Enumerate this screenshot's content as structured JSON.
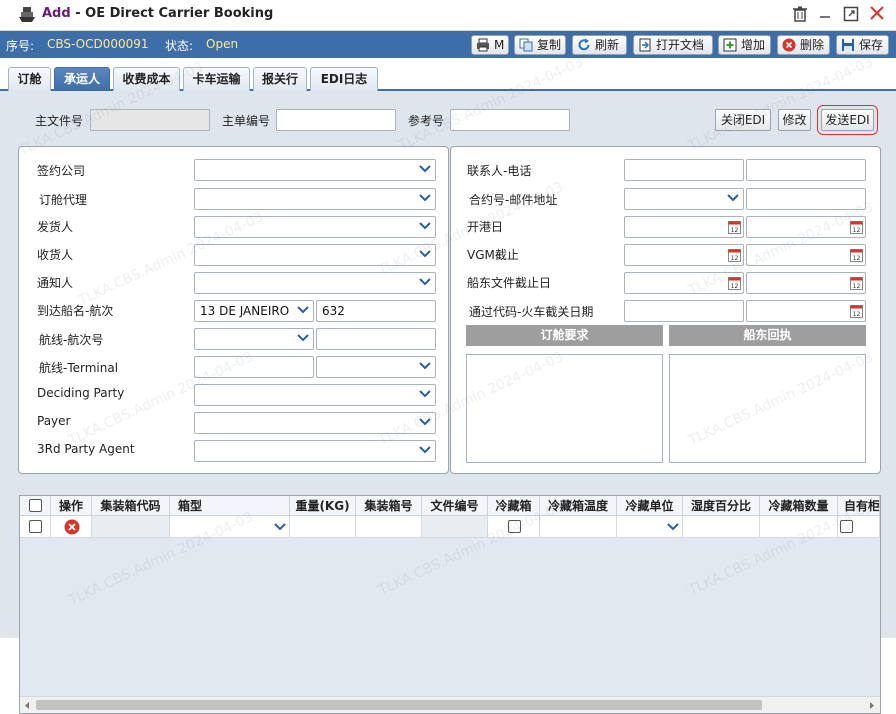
{
  "window": {
    "add_label": "Add",
    "title_sep": " - ",
    "title": "OE Direct Carrier Booking"
  },
  "info": {
    "seq_label": "序号:",
    "seq_value": "CBS-OCD000091",
    "status_label": "状态:",
    "status_value": "Open"
  },
  "toolbar": {
    "print": "M",
    "copy": "复制",
    "refresh": "刷新",
    "open_doc": "打开文档",
    "add": "增加",
    "delete": "删除",
    "save": "保存"
  },
  "tabs": [
    "订舱",
    "承运人",
    "收费成本",
    "卡车运输",
    "报关行",
    "EDI日志"
  ],
  "header_fields": {
    "main_doc_label": "主文件号",
    "main_doc_value": "",
    "master_no_label": "主单编号",
    "master_no_value": "",
    "ref_label": "参考号",
    "ref_value": "",
    "close_edi": "关闭EDI",
    "modify": "修改",
    "send_edi": "发送EDI"
  },
  "left": {
    "contract_company": "签约公司",
    "booking_agent": "订舱代理",
    "shipper": "发货人",
    "consignee": "收货人",
    "notify": "通知人",
    "vessel_label": "到达船名-航次",
    "vessel_value": "13 DE JANEIRO",
    "voyage_value": "632",
    "route_voyage": "航线-航次号",
    "route_terminal": "航线-Terminal",
    "deciding_party": "Deciding Party",
    "payer": "Payer",
    "third_party": "3Rd Party Agent"
  },
  "right": {
    "contact_phone": "联系人-电话",
    "contract_mail": "合约号-邮件地址",
    "sail_date": "开港日",
    "vgm_cutoff": "VGM截止",
    "doc_cutoff": "船东文件截止日",
    "pass_code": "通过代码-火车截关日期",
    "booking_req": "订舱要求",
    "carrier_reply": "船东回执"
  },
  "grid": {
    "headers": [
      "操作",
      "集装箱代码",
      "箱型",
      "重量(KG)",
      "集装箱号",
      "文件编号",
      "冷藏箱",
      "冷藏箱温度",
      "冷藏单位",
      "湿度百分比",
      "冷藏箱数量",
      "自有柜"
    ]
  },
  "watermark": "TLKA.CBS.Admin 2024-04-03",
  "colors": {
    "accent": "#3d6ea8",
    "status": "#ffe98a",
    "delete": "#d9342b"
  }
}
